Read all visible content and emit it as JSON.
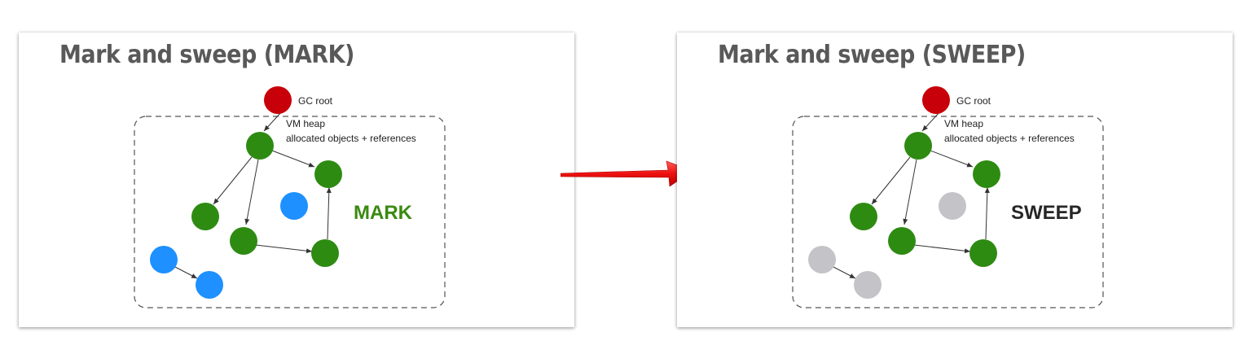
{
  "slides": [
    {
      "id": "mark",
      "title": "Mark and sweep (MARK)",
      "gc_root_label": "GC root",
      "heap_label_line1": "VM heap",
      "heap_label_line2": "allocated objects + references",
      "phase_label": "MARK",
      "phase_color": "#3a8a12",
      "root_color": "#c8000a",
      "reachable_color": "#2e8b12",
      "unreachable_color": "#1e90ff"
    },
    {
      "id": "sweep",
      "title": "Mark and sweep (SWEEP)",
      "gc_root_label": "GC root",
      "heap_label_line1": "VM heap",
      "heap_label_line2": "allocated objects + references",
      "phase_label": "SWEEP",
      "phase_color": "#262626",
      "root_color": "#c8000a",
      "reachable_color": "#2e8b12",
      "unreachable_color": "#c4c4c8"
    }
  ],
  "transition_arrow_color": "#ee1111"
}
